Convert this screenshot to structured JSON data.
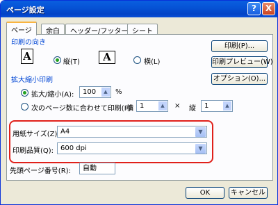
{
  "window": {
    "title": "ページ設定"
  },
  "titlebar_buttons": {
    "help": "?",
    "close": "X"
  },
  "tabs": [
    "ページ",
    "余白",
    "ヘッダー/フッター",
    "シート"
  ],
  "orientation": {
    "label": "印刷の向き",
    "portrait": "縦(T)",
    "landscape": "横(L)",
    "portrait_icon": "A",
    "landscape_icon": "A"
  },
  "buttons": {
    "print": "印刷(P)...",
    "preview": "印刷プレビュー(W)",
    "options": "オプション(O)...",
    "ok": "OK",
    "cancel": "キャンセル"
  },
  "scaling": {
    "label": "拡大縮小印刷",
    "zoom_label": "拡大/縮小(A):",
    "zoom_value": "100",
    "zoom_unit": "%",
    "fit_label": "次のページ数に合わせて印刷(F):",
    "wide_label": "横",
    "wide_value": "1",
    "times": "×",
    "tall_label": "縦",
    "tall_value": "1"
  },
  "paper_size": {
    "label": "用紙サイズ(Z):",
    "value": "A4"
  },
  "print_quality": {
    "label": "印刷品質(Q):",
    "value": "600 dpi"
  },
  "first_page": {
    "label": "先頭ページ番号(R):",
    "value": "自動"
  },
  "icons": {
    "spin_up": "▲",
    "spin_down": "▼",
    "dropdown": "▼"
  }
}
